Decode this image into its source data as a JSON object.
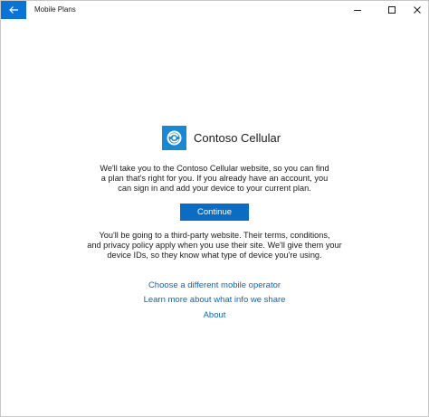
{
  "window": {
    "title": "Mobile Plans",
    "controls": {
      "back_icon": "arrow-left-icon",
      "minimize_icon": "minimize-icon",
      "maximize_icon": "maximize-icon",
      "close_icon": "close-icon"
    }
  },
  "brand": {
    "name": "Contoso Cellular",
    "logo_icon": "contoso-swirl-logo-icon"
  },
  "intro": {
    "lines": [
      "We'll take you to the Contoso Cellular website, so you can find",
      "a plan that's right for you. If you already have an account, you",
      "can sign in and add your device to your current plan."
    ]
  },
  "continue_label": "Continue",
  "disclaimer": {
    "lines": [
      "You'll be going to a third-party website. Their terms, conditions,",
      "and privacy policy apply when you use their site. We'll give them your",
      "device IDs, so they know what type of device you're using."
    ]
  },
  "links": {
    "choose_operator": "Choose a different mobile operator",
    "learn_more": "Learn more about what info we share",
    "about": "About"
  },
  "colors": {
    "accent": "#0a74d6",
    "button": "#0b6cc4",
    "link": "#0a66bf",
    "logo": "#1788d1"
  }
}
